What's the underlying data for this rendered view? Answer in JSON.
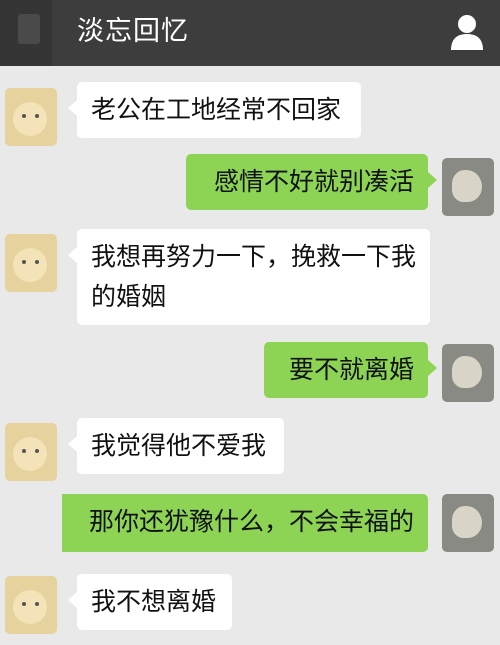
{
  "header": {
    "title": "淡忘回忆",
    "profile_icon": "person-icon",
    "back_icon": "back-icon"
  },
  "colors": {
    "header_bg": "#3d3d3d",
    "chat_bg": "#e9e9e9",
    "incoming_bubble": "#ffffff",
    "outgoing_bubble": "#8dd455"
  },
  "messages": [
    {
      "side": "in",
      "text": "老公在工地经常不回家"
    },
    {
      "side": "out",
      "text": "感情不好就别凑活"
    },
    {
      "side": "in",
      "text": "我想再努力一下，挽救一下我的婚姻"
    },
    {
      "side": "out",
      "text": "要不就离婚"
    },
    {
      "side": "in",
      "text": "我觉得他不爱我"
    },
    {
      "side": "out",
      "text": "那你还犹豫什么，不会幸福的"
    },
    {
      "side": "in",
      "text": "我不想离婚"
    }
  ]
}
